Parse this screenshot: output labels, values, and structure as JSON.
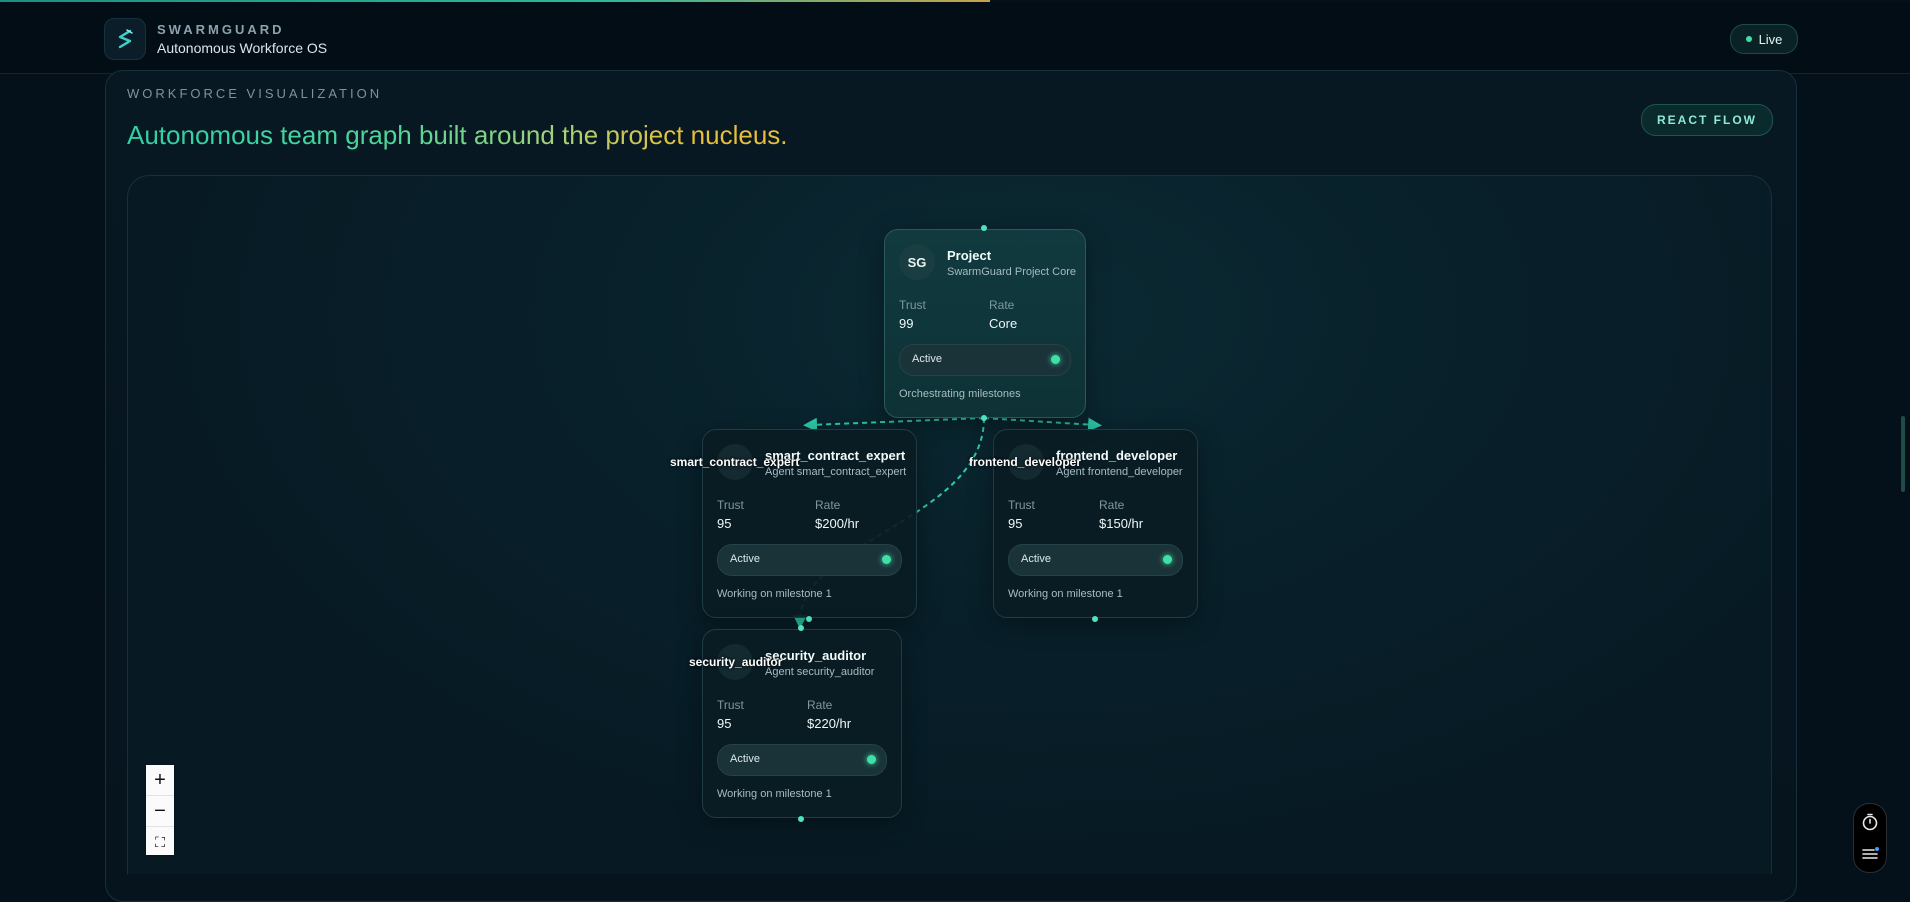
{
  "app": {
    "brand_name": "SWARMGUARD",
    "brand_subtitle": "Autonomous Workforce OS",
    "status_chip": "Live"
  },
  "section": {
    "kicker": "WORKFORCE VISUALIZATION",
    "title": "Autonomous team graph built around the project nucleus.",
    "badge": "REACT FLOW"
  },
  "nodes": {
    "project": {
      "avatar": "SG",
      "title": "Project",
      "subtitle": "SwarmGuard Project Core",
      "trust_label": "Trust",
      "trust": "99",
      "rate_label": "Rate",
      "rate": "Core",
      "status": "Active",
      "footer": "Orchestrating milestones"
    },
    "smart_contract": {
      "title": "smart_contract_expert",
      "subtitle": "Agent smart_contract_expert",
      "trust_label": "Trust",
      "trust": "95",
      "rate_label": "Rate",
      "rate": "$200/hr",
      "status": "Active",
      "footer": "Working on milestone 1"
    },
    "frontend": {
      "title": "frontend_developer",
      "subtitle": "Agent frontend_developer",
      "trust_label": "Trust",
      "trust": "95",
      "rate_label": "Rate",
      "rate": "$150/hr",
      "status": "Active",
      "footer": "Working on milestone 1"
    },
    "security": {
      "title": "security_auditor",
      "subtitle": "Agent security_auditor",
      "trust_label": "Trust",
      "trust": "95",
      "rate_label": "Rate",
      "rate": "$220/hr",
      "status": "Active",
      "footer": "Working on milestone 1"
    }
  },
  "edge_labels": {
    "smart_contract": "smart_contract_expert",
    "frontend": "frontend_developer",
    "security": "security_auditor"
  },
  "controls": {
    "zoom_in": "+",
    "zoom_out": "−",
    "fit_view": "⛶"
  },
  "icons": [
    "swarmguard-logo-icon",
    "timer-icon",
    "menu-icon",
    "fit-view-icon"
  ],
  "colors": {
    "accent": "#3fe0a8",
    "edge": "#2ec9a8",
    "title_gradient_start": "#2fcfa6",
    "title_gradient_end": "#e8bf3a",
    "background": "#04101a"
  }
}
